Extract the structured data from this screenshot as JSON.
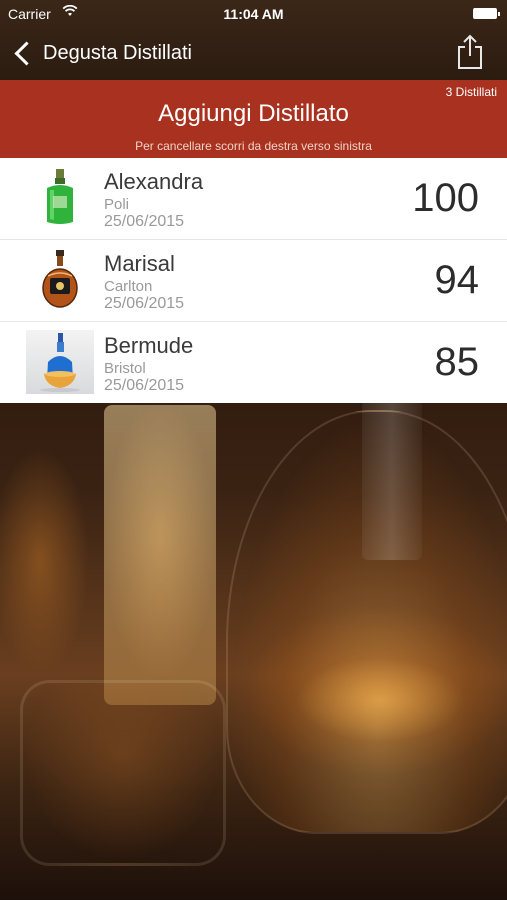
{
  "status_bar": {
    "carrier": "Carrier",
    "time": "11:04 AM"
  },
  "nav": {
    "back_label": "Degusta Distillati",
    "share_icon": "share-icon"
  },
  "banner": {
    "count": "3 Distillati",
    "title": "Aggiungi Distillato",
    "hint": "Per cancellare scorri da destra verso sinistra"
  },
  "colors": {
    "banner": "#a8321f",
    "header": "#2c1b10"
  },
  "items": [
    {
      "name": "Alexandra",
      "producer": "Poli",
      "date": "25/06/2015",
      "score": "100",
      "icon": "green-bottle-icon"
    },
    {
      "name": "Marisal",
      "producer": "Carlton",
      "date": "25/06/2015",
      "score": "94",
      "icon": "cognac-bottle-icon"
    },
    {
      "name": "Bermude",
      "producer": "Bristol",
      "date": "25/06/2015",
      "score": "85",
      "icon": "blue-bottle-icon"
    }
  ]
}
